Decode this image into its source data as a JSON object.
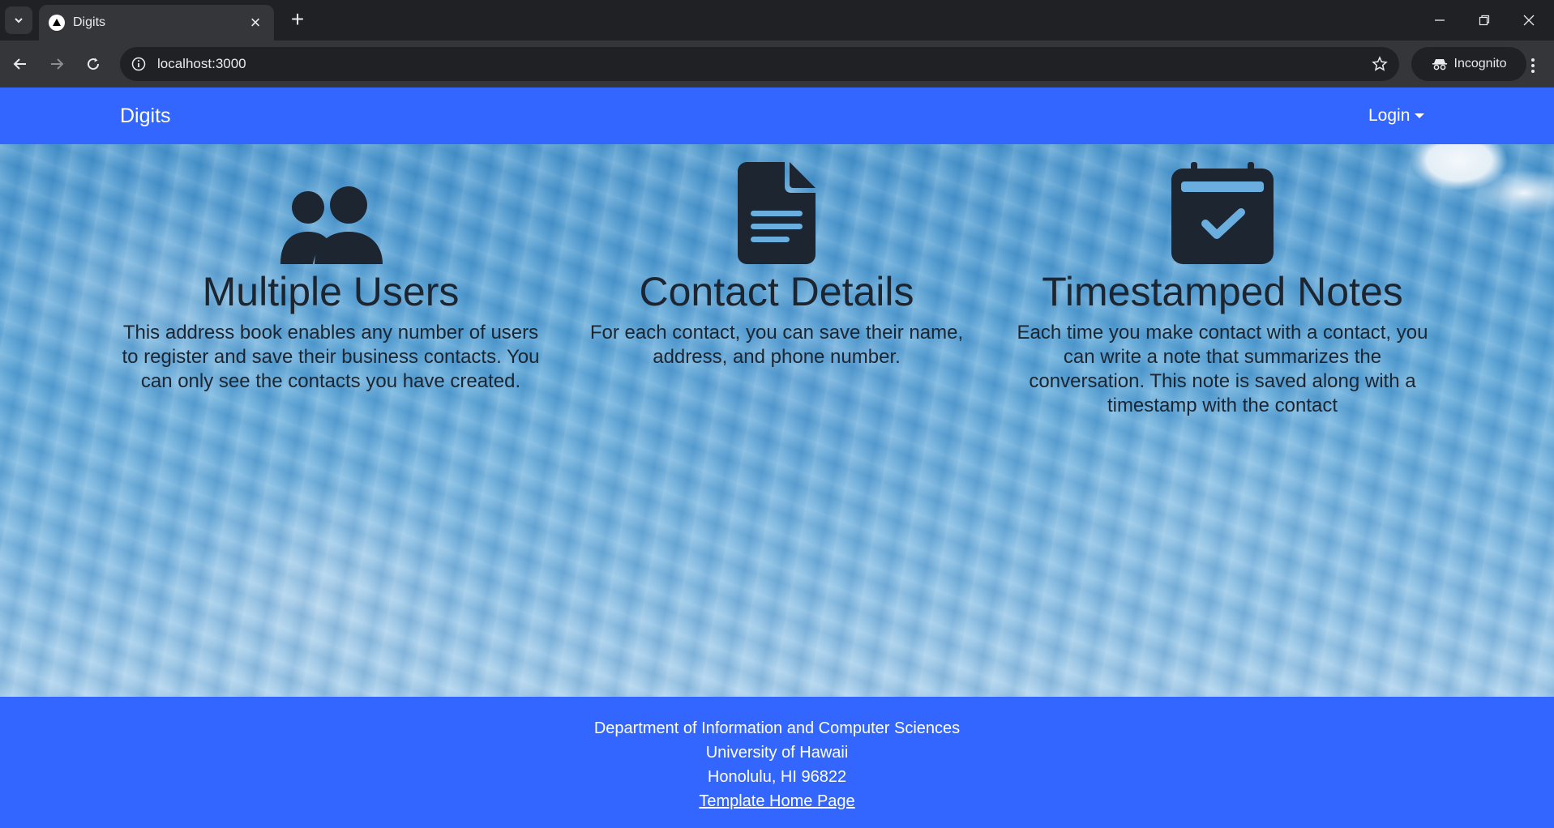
{
  "browser": {
    "tab_title": "Digits",
    "url": "localhost:3000",
    "incognito_label": "Incognito"
  },
  "navbar": {
    "brand": "Digits",
    "login_label": "Login"
  },
  "features": [
    {
      "icon": "users-icon",
      "title": "Multiple Users",
      "text": "This address book enables any number of users to register and save their business contacts. You can only see the contacts you have created."
    },
    {
      "icon": "file-text-icon",
      "title": "Contact Details",
      "text": "For each contact, you can save their name, address, and phone number."
    },
    {
      "icon": "calendar-check-icon",
      "title": "Timestamped Notes",
      "text": "Each time you make contact with a contact, you can write a note that summarizes the conversation. This note is saved along with a timestamp with the contact"
    }
  ],
  "footer": {
    "line1": "Department of Information and Computer Sciences",
    "line2": "University of Hawaii",
    "line3": "Honolulu, HI 96822",
    "link": "Template Home Page"
  },
  "colors": {
    "brand_blue": "#3366ff",
    "icon_dark": "#1c2530"
  }
}
